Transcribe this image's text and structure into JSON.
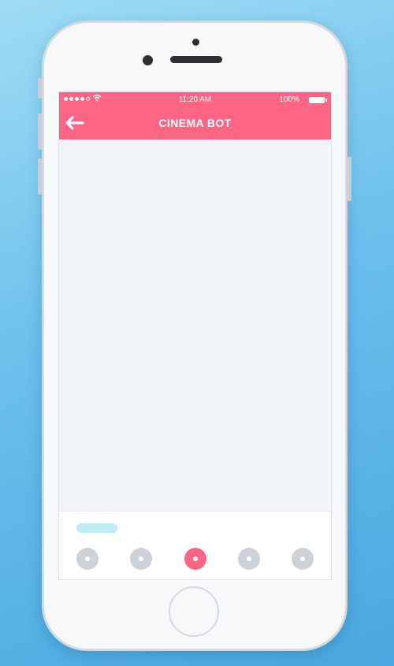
{
  "status_bar": {
    "time": "11:20 AM",
    "battery": "100%"
  },
  "header": {
    "title": "CINEMA BOT",
    "back_icon": "back-arrow-icon",
    "color": "#ff6685"
  },
  "pager": {
    "count": 5,
    "active_index": 2,
    "active_color": "#ff6685",
    "inactive_color": "#ccd2da"
  },
  "typing_indicator": {
    "color": "#bcecf5"
  }
}
